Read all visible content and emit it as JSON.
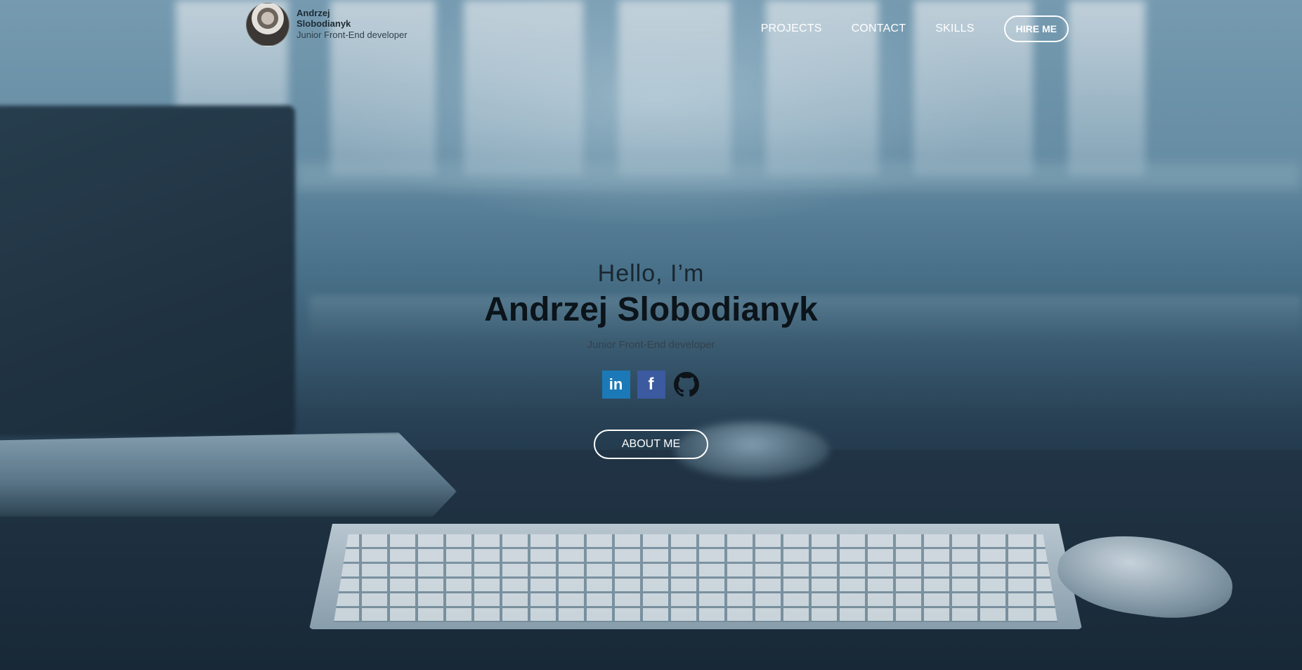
{
  "header": {
    "name": "Andrzej Slobodianyk",
    "role": "Junior Front-End developer",
    "nav": [
      "PROJECTS",
      "CONTACT",
      "SKILLS"
    ],
    "cta": "HIRE ME"
  },
  "hero": {
    "greeting": "Hello, I’m",
    "name": "Andrzej Slobodianyk",
    "subtitle": "Junior Front-End developer",
    "socials": {
      "linkedin": "in",
      "facebook": "f",
      "github": "github-icon"
    },
    "about_button": "ABOUT ME"
  },
  "colors": {
    "linkedin": "#1c79b7",
    "facebook": "#3b5aa0",
    "button_border": "#ffffff"
  }
}
